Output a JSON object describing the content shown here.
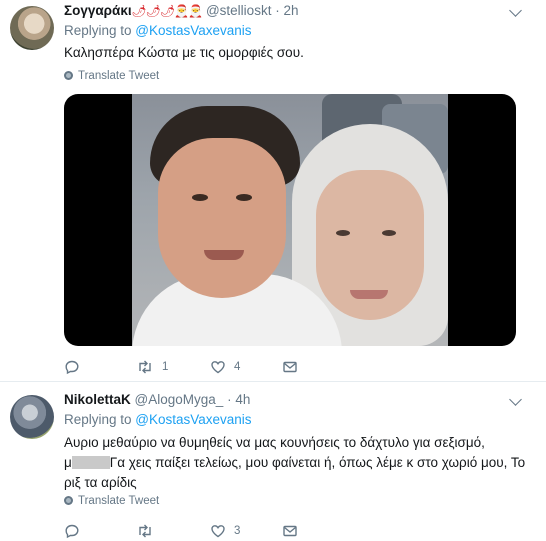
{
  "tweets": [
    {
      "name": "Σογγαράκι",
      "name_emoji": "🌶🌶🌶🎅🎅",
      "handle": "@stellioskt",
      "dot": "·",
      "time": "2h",
      "replying_prefix": "Replying to ",
      "replying_to": "@KostasVaxevanis",
      "text": "Καλησπέρα Κώστα με τις ομορφιές σου.",
      "translate": "Translate Tweet",
      "has_media": true,
      "actions": {
        "reply": "",
        "retweet": "1",
        "like": "4"
      }
    },
    {
      "name": "NikolettaK",
      "handle": "@AlogoMyga_",
      "dot": "·",
      "time": "4h",
      "replying_prefix": "Replying to ",
      "replying_to": "@KostasVaxevanis",
      "text_line1": "Αυριο μεθαύριο να θυμηθείς να μας κουνήσεις το δάχτυλο για σεξισμό,",
      "text_line2_pre": "μ",
      "text_line2_post": "Γα χεις παίξει τελείως, μου φαίνεται ή, όπως λέμε κ στο χωριό μου, Το",
      "text_line3": "ριξ τα αρίδις",
      "translate": "Translate Tweet",
      "actions": {
        "reply": "",
        "retweet": "",
        "like": "3"
      }
    }
  ],
  "colors": {
    "link": "#1da1f2",
    "secondary": "#657786",
    "text": "#14171a",
    "divider": "#e6ecf0"
  }
}
